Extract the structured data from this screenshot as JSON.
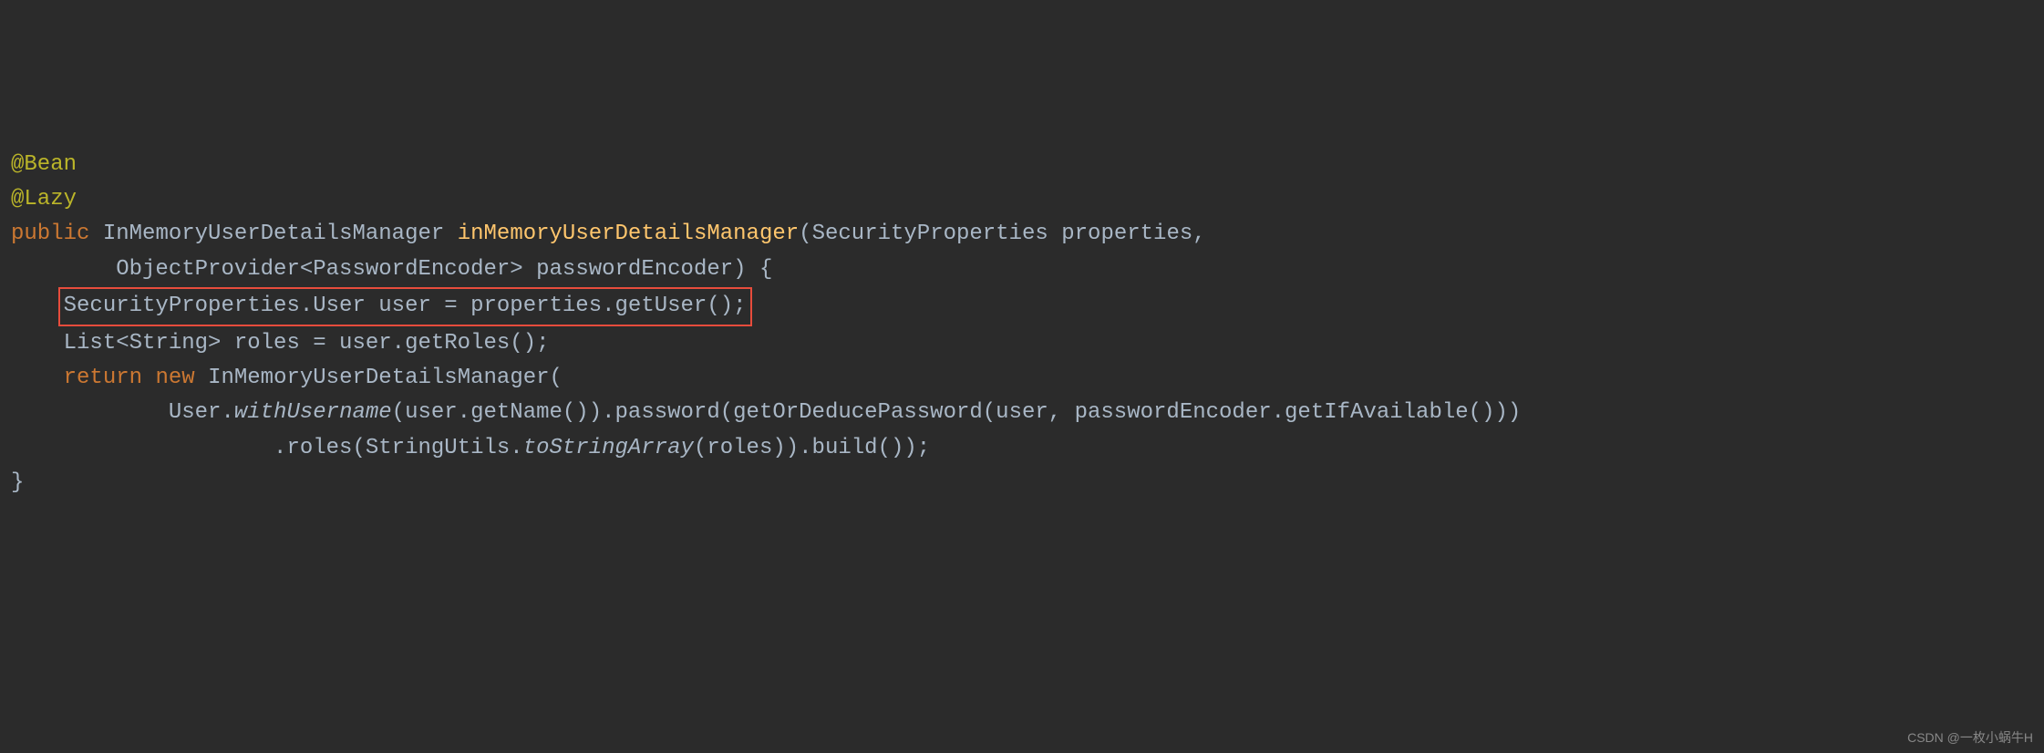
{
  "code": {
    "annotation1": "@Bean",
    "annotation2": "@Lazy",
    "kw_public": "public",
    "type_inmem": "InMemoryUserDetailsManager",
    "method_name": "inMemoryUserDetailsManager",
    "param_type1": "SecurityProperties",
    "param_name1": "properties",
    "param_type2": "ObjectProvider<PasswordEncoder>",
    "param_name2": "passwordEncoder",
    "line_highlighted": "SecurityProperties.User user = properties.getUser();",
    "line_roles": "    List<String> roles = user.getRoles();",
    "kw_return": "return",
    "kw_new": "new",
    "ctor_type": "InMemoryUserDetailsManager",
    "user_class": "User",
    "withUsername": "withUsername",
    "call_chain1": "(user.getName()).password(getOrDeducePassword(user, passwordEncoder.getIfAvailable()))",
    "roles_call_pre": "                    .roles(StringUtils.",
    "toStringArray": "toStringArray",
    "roles_call_post": "(roles)).build());",
    "close_brace": "}"
  },
  "watermark": "CSDN @一枚小蜗牛H"
}
